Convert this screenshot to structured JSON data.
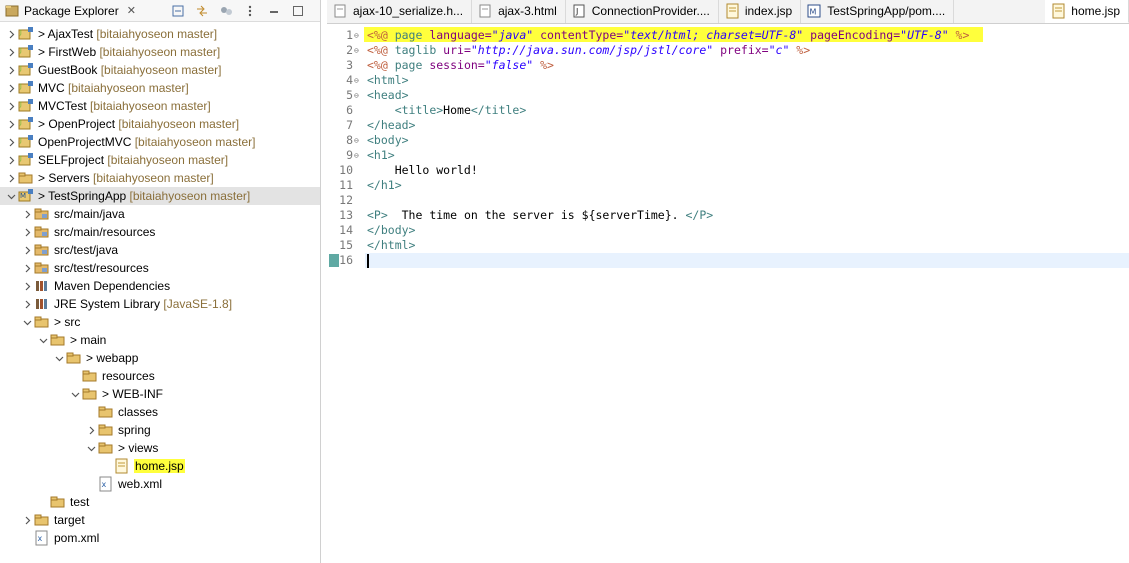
{
  "explorer": {
    "title": "Package Explorer",
    "close_glyph": "✕",
    "tree": [
      {
        "name": "AjaxTest",
        "suffix": "[bitaiahyoseon master]",
        "dirty": true,
        "indent": 0,
        "twisty": "right",
        "icon": "project-icon"
      },
      {
        "name": "FirstWeb",
        "suffix": "[bitaiahyoseon master]",
        "dirty": true,
        "indent": 0,
        "twisty": "right",
        "icon": "project-icon"
      },
      {
        "name": "GuestBook",
        "suffix": "[bitaiahyoseon master]",
        "dirty": false,
        "indent": 0,
        "twisty": "right",
        "icon": "project-icon"
      },
      {
        "name": "MVC",
        "suffix": "[bitaiahyoseon master]",
        "dirty": false,
        "indent": 0,
        "twisty": "right",
        "icon": "project-icon"
      },
      {
        "name": "MVCTest",
        "suffix": "[bitaiahyoseon master]",
        "dirty": false,
        "indent": 0,
        "twisty": "right",
        "icon": "project-icon"
      },
      {
        "name": "OpenProject",
        "suffix": "[bitaiahyoseon master]",
        "dirty": true,
        "indent": 0,
        "twisty": "right",
        "icon": "project-icon"
      },
      {
        "name": "OpenProjectMVC",
        "suffix": "[bitaiahyoseon master]",
        "dirty": false,
        "indent": 0,
        "twisty": "right",
        "icon": "project-icon"
      },
      {
        "name": "SELFproject",
        "suffix": "[bitaiahyoseon master]",
        "dirty": false,
        "indent": 0,
        "twisty": "right",
        "icon": "project-icon"
      },
      {
        "name": "Servers",
        "suffix": "[bitaiahyoseon master]",
        "dirty": true,
        "indent": 0,
        "twisty": "right",
        "icon": "folder-icon"
      },
      {
        "name": "TestSpringApp",
        "suffix": "[bitaiahyoseon master]",
        "dirty": true,
        "indent": 0,
        "twisty": "down",
        "icon": "maven-project-icon",
        "selected": true
      },
      {
        "name": "src/main/java",
        "suffix": "",
        "dirty": false,
        "indent": 1,
        "twisty": "right",
        "icon": "source-folder-icon"
      },
      {
        "name": "src/main/resources",
        "suffix": "",
        "dirty": false,
        "indent": 1,
        "twisty": "right",
        "icon": "source-folder-icon"
      },
      {
        "name": "src/test/java",
        "suffix": "",
        "dirty": false,
        "indent": 1,
        "twisty": "right",
        "icon": "source-folder-icon"
      },
      {
        "name": "src/test/resources",
        "suffix": "",
        "dirty": false,
        "indent": 1,
        "twisty": "right",
        "icon": "source-folder-icon"
      },
      {
        "name": "Maven Dependencies",
        "suffix": "",
        "dirty": false,
        "indent": 1,
        "twisty": "right",
        "icon": "library-icon"
      },
      {
        "name": "JRE System Library",
        "suffix": "[JavaSE-1.8]",
        "dirty": false,
        "indent": 1,
        "twisty": "right",
        "icon": "library-icon"
      },
      {
        "name": "src",
        "suffix": "",
        "dirty": true,
        "indent": 1,
        "twisty": "down",
        "icon": "folder-icon"
      },
      {
        "name": "main",
        "suffix": "",
        "dirty": true,
        "indent": 2,
        "twisty": "down",
        "icon": "folder-icon"
      },
      {
        "name": "webapp",
        "suffix": "",
        "dirty": true,
        "indent": 3,
        "twisty": "down",
        "icon": "folder-icon"
      },
      {
        "name": "resources",
        "suffix": "",
        "dirty": false,
        "indent": 4,
        "twisty": "",
        "icon": "folder-icon"
      },
      {
        "name": "WEB-INF",
        "suffix": "",
        "dirty": true,
        "indent": 4,
        "twisty": "down",
        "icon": "folder-icon"
      },
      {
        "name": "classes",
        "suffix": "",
        "dirty": false,
        "indent": 5,
        "twisty": "",
        "icon": "folder-icon"
      },
      {
        "name": "spring",
        "suffix": "",
        "dirty": false,
        "indent": 5,
        "twisty": "right",
        "icon": "folder-icon"
      },
      {
        "name": "views",
        "suffix": "",
        "dirty": true,
        "indent": 5,
        "twisty": "down",
        "icon": "folder-icon"
      },
      {
        "name": "home.jsp",
        "suffix": "",
        "dirty": false,
        "indent": 6,
        "twisty": "",
        "icon": "jsp-file-icon",
        "highlight": true
      },
      {
        "name": "web.xml",
        "suffix": "",
        "dirty": false,
        "indent": 5,
        "twisty": "",
        "icon": "xml-file-icon"
      },
      {
        "name": "test",
        "suffix": "",
        "dirty": false,
        "indent": 2,
        "twisty": "",
        "icon": "folder-icon"
      },
      {
        "name": "target",
        "suffix": "",
        "dirty": false,
        "indent": 1,
        "twisty": "right",
        "icon": "folder-icon"
      },
      {
        "name": "pom.xml",
        "suffix": "",
        "dirty": false,
        "indent": 1,
        "twisty": "",
        "icon": "xml-file-icon"
      }
    ]
  },
  "editor": {
    "tabs": [
      {
        "label": "ajax-10_serialize.h...",
        "icon": "html-file-icon",
        "active": false
      },
      {
        "label": "ajax-3.html",
        "icon": "html-file-icon",
        "active": false
      },
      {
        "label": "ConnectionProvider....",
        "icon": "java-file-icon",
        "active": false
      },
      {
        "label": "index.jsp",
        "icon": "jsp-file-icon",
        "active": false
      },
      {
        "label": "TestSpringApp/pom....",
        "icon": "maven-file-icon",
        "active": false
      },
      {
        "label": "home.jsp",
        "icon": "jsp-file-icon",
        "active": true
      }
    ],
    "lines": [
      {
        "n": "1",
        "fold": "⊖",
        "tokens": [
          [
            "dir",
            "<%@ "
          ],
          [
            "tg",
            "page "
          ],
          [
            "at",
            "language="
          ],
          [
            "av",
            "\"java\""
          ],
          [
            "at",
            " contentType="
          ],
          [
            "av",
            "\"text/html; charset=UTF-8\""
          ],
          [
            "at",
            " pageEncoding="
          ],
          [
            "av",
            "\"UTF-8\""
          ],
          [
            "dir",
            " %>"
          ]
        ]
      },
      {
        "n": "2",
        "fold": "⊖",
        "tokens": [
          [
            "dir",
            "<%@ "
          ],
          [
            "tg",
            "taglib "
          ],
          [
            "at",
            "uri="
          ],
          [
            "av",
            "\"http://java.sun.com/jsp/jstl/core\""
          ],
          [
            "at",
            " prefix="
          ],
          [
            "av",
            "\"c\""
          ],
          [
            "dir",
            " %>"
          ]
        ]
      },
      {
        "n": "3",
        "fold": "",
        "tokens": [
          [
            "dir",
            "<%@ "
          ],
          [
            "tg",
            "page "
          ],
          [
            "at",
            "session="
          ],
          [
            "av",
            "\"false\""
          ],
          [
            "dir",
            " %>"
          ]
        ]
      },
      {
        "n": "4",
        "fold": "⊖",
        "tokens": [
          [
            "tg",
            "<html>"
          ]
        ]
      },
      {
        "n": "5",
        "fold": "⊖",
        "tokens": [
          [
            "tg",
            "<head>"
          ]
        ]
      },
      {
        "n": "6",
        "fold": "",
        "tokens": [
          [
            "",
            "    "
          ],
          [
            "tg",
            "<title>"
          ],
          [
            "",
            "Home"
          ],
          [
            "tg",
            "</title>"
          ]
        ]
      },
      {
        "n": "7",
        "fold": "",
        "tokens": [
          [
            "tg",
            "</head>"
          ]
        ]
      },
      {
        "n": "8",
        "fold": "⊖",
        "tokens": [
          [
            "tg",
            "<body>"
          ]
        ]
      },
      {
        "n": "9",
        "fold": "⊖",
        "tokens": [
          [
            "tg",
            "<h1>"
          ]
        ]
      },
      {
        "n": "10",
        "fold": "",
        "tokens": [
          [
            "",
            "    Hello world!"
          ]
        ]
      },
      {
        "n": "11",
        "fold": "",
        "tokens": [
          [
            "tg",
            "</h1>"
          ]
        ]
      },
      {
        "n": "12",
        "fold": "",
        "tokens": []
      },
      {
        "n": "13",
        "fold": "",
        "tokens": [
          [
            "tg",
            "<P>"
          ],
          [
            "",
            "  The time on the server is ${serverTime}. "
          ],
          [
            "tg",
            "</P>"
          ]
        ]
      },
      {
        "n": "14",
        "fold": "",
        "tokens": [
          [
            "tg",
            "</body>"
          ]
        ]
      },
      {
        "n": "15",
        "fold": "",
        "tokens": [
          [
            "tg",
            "</html>"
          ]
        ]
      },
      {
        "n": "16",
        "fold": "",
        "tokens": []
      }
    ]
  },
  "colors": {
    "highlight": "#ffff3c",
    "tag": "#3f7f7f",
    "attr_name": "#7f007f",
    "attr_value": "#2a00ff",
    "directive": "#bf5f3f",
    "branch_suffix": "#8a6f3a"
  }
}
